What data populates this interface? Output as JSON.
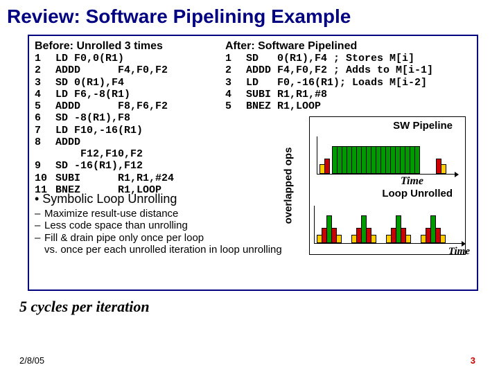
{
  "title": "Review: Software Pipelining Example",
  "before": {
    "header": "Before: Unrolled 3 times",
    "lines": [
      {
        "n": "1",
        "t": "LD F0,0(R1)"
      },
      {
        "n": "2",
        "t": "ADDD      F4,F0,F2"
      },
      {
        "n": "3",
        "t": "SD 0(R1),F4"
      },
      {
        "n": "4",
        "t": "LD F6,-8(R1)"
      },
      {
        "n": "5",
        "t": "ADDD      F8,F6,F2"
      },
      {
        "n": "6",
        "t": "SD -8(R1),F8"
      },
      {
        "n": "7",
        "t": "LD F10,-16(R1)"
      },
      {
        "n": "8",
        "t": "ADDD"
      },
      {
        "n": "",
        "t": "    F12,F10,F2"
      },
      {
        "n": "9",
        "t": "SD -16(R1),F12"
      },
      {
        "n": "10",
        "t": "SUBI      R1,R1,#24"
      },
      {
        "n": "11",
        "t": "BNEZ      R1,LOOP"
      }
    ]
  },
  "after": {
    "header": "After: Software Pipelined",
    "lines": [
      {
        "n": "1",
        "t": "SD   0(R1),F4 ; Stores M[i]"
      },
      {
        "n": "2",
        "t": "ADDD F4,F0,F2 ; Adds to M[i-1]"
      },
      {
        "n": "3",
        "t": "LD   F0,-16(R1); Loads M[i-2]"
      },
      {
        "n": "4",
        "t": "SUBI R1,R1,#8"
      },
      {
        "n": "5",
        "t": "BNEZ R1,LOOP"
      }
    ]
  },
  "symbolic": "• Symbolic Loop Unrolling",
  "bullets": [
    "Maximize result-use distance",
    "Less code space than unrolling",
    "Fill & drain pipe only once per loop",
    "vs. once per each unrolled iteration in loop unrolling"
  ],
  "chart": {
    "ylabel": "overlapped ops",
    "sw_label": "SW Pipeline",
    "lu_label": "Loop Unrolled",
    "time1": "Time",
    "time2": "Time"
  },
  "five_cycles": "5 cycles per iteration",
  "footer": {
    "date": "2/8/05",
    "page": "3"
  },
  "chart_data": {
    "type": "bar",
    "note": "Two schematic timelines comparing overlapped ops (y) vs time (x). Heights are relative (0-1).",
    "sw_pipeline_groups": [
      {
        "fill": [
          0.3
        ],
        "steady": [
          1,
          1,
          1,
          1,
          1,
          1,
          1,
          1,
          1,
          1,
          1,
          1,
          1,
          1
        ],
        "drain": [
          0.3
        ]
      }
    ],
    "loop_unrolled_groups": [
      {
        "ramp": [
          0.3,
          0.6,
          1.0,
          0.6,
          0.3
        ]
      },
      {
        "ramp": [
          0.3,
          0.6,
          1.0,
          0.6,
          0.3
        ]
      },
      {
        "ramp": [
          0.3,
          0.6,
          1.0,
          0.6,
          0.3
        ]
      },
      {
        "ramp": [
          0.3,
          0.6,
          1.0,
          0.6,
          0.3
        ]
      }
    ],
    "colors": {
      "fill_drain": "#ffcc00",
      "steady": "#009900",
      "edge": "#cc0000"
    }
  }
}
